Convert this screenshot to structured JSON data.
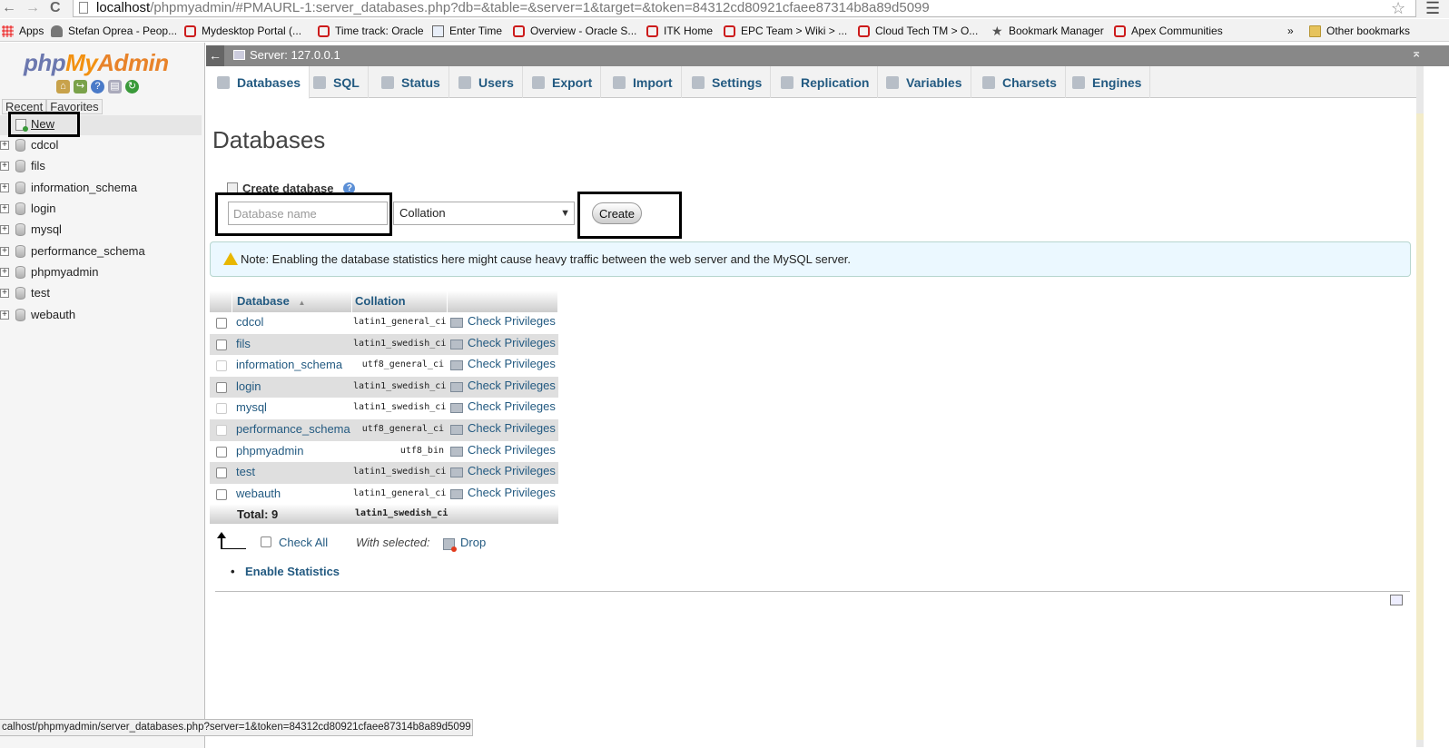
{
  "browser": {
    "url_host": "localhost",
    "url_path": "/phpmyadmin/#PMAURL-1:server_databases.php?db=&table=&server=1&target=&token=84312cd80921cfaee87314b8a89d5099",
    "nav_back": "←",
    "nav_forward": "→",
    "reload": "C",
    "star": "☆",
    "menu": "☰",
    "bookmarks": [
      {
        "label": "Apps",
        "icon": "apps-icon"
      },
      {
        "label": "Stefan Oprea - Peop...",
        "icon": "person-icon"
      },
      {
        "label": "Mydesktop Portal (...",
        "icon": "oracle-icon"
      },
      {
        "label": "Time track: Oracle",
        "icon": "oracle-icon"
      },
      {
        "label": "Enter Time",
        "icon": "page-icon"
      },
      {
        "label": "Overview - Oracle S...",
        "icon": "oracle-icon"
      },
      {
        "label": "ITK Home",
        "icon": "oracle-icon"
      },
      {
        "label": "EPC Team > Wiki > ...",
        "icon": "wiki-icon"
      },
      {
        "label": "Cloud Tech TM > O...",
        "icon": "wiki-icon"
      },
      {
        "label": "Bookmark Manager",
        "icon": "star-icon"
      },
      {
        "label": "Apex Communities",
        "icon": "oracle-icon"
      }
    ],
    "bookmarks_more": "»",
    "other_bookmarks": "Other bookmarks",
    "status_url": "calhost/phpmyadmin/server_databases.php?server=1&token=84312cd80921cfaee87314b8a89d5099"
  },
  "left": {
    "logo_php": "php",
    "logo_my": "My",
    "logo_admin": "Admin",
    "tab_recent": "Recent",
    "tab_favorites": "Favorites",
    "new_label": "New",
    "databases": [
      "cdcol",
      "fils",
      "information_schema",
      "login",
      "mysql",
      "performance_schema",
      "phpmyadmin",
      "test",
      "webauth"
    ]
  },
  "server": {
    "back": "←",
    "title": "Server: 127.0.0.1",
    "collapse": "⌅"
  },
  "menu": [
    {
      "label": "Databases",
      "active": true
    },
    {
      "label": "SQL"
    },
    {
      "label": "Status"
    },
    {
      "label": "Users"
    },
    {
      "label": "Export"
    },
    {
      "label": "Import"
    },
    {
      "label": "Settings"
    },
    {
      "label": "Replication"
    },
    {
      "label": "Variables"
    },
    {
      "label": "Charsets"
    },
    {
      "label": "Engines"
    }
  ],
  "main": {
    "title": "Databases",
    "create_legend": "Create database",
    "dbname_placeholder": "Database name",
    "collation": "Collation",
    "create_button": "Create",
    "note": "Note: Enabling the database statistics here might cause heavy traffic between the web server and the MySQL server.",
    "table": {
      "col_database": "Database",
      "sort_indicator": "▲",
      "col_collation": "Collation",
      "rows": [
        {
          "name": "cdcol",
          "collation": "latin1_general_ci",
          "action": "Check Privileges"
        },
        {
          "name": "fils",
          "collation": "latin1_swedish_ci",
          "action": "Check Privileges"
        },
        {
          "name": "information_schema",
          "collation": "utf8_general_ci",
          "action": "Check Privileges"
        },
        {
          "name": "login",
          "collation": "latin1_swedish_ci",
          "action": "Check Privileges"
        },
        {
          "name": "mysql",
          "collation": "latin1_swedish_ci",
          "action": "Check Privileges"
        },
        {
          "name": "performance_schema",
          "collation": "utf8_general_ci",
          "action": "Check Privileges"
        },
        {
          "name": "phpmyadmin",
          "collation": "utf8_bin",
          "action": "Check Privileges"
        },
        {
          "name": "test",
          "collation": "latin1_swedish_ci",
          "action": "Check Privileges"
        },
        {
          "name": "webauth",
          "collation": "latin1_general_ci",
          "action": "Check Privileges"
        }
      ],
      "total_label": "Total: 9",
      "total_collation": "latin1_swedish_ci"
    },
    "check_all": "Check All",
    "with_selected": "With selected:",
    "drop": "Drop",
    "enable_statistics": "Enable Statistics"
  },
  "colors": {
    "link": "#235a81",
    "logo_php": "#6c78af",
    "logo_myadmin": "#f29111",
    "server_bar": "#888888",
    "note_bg": "#ebf8ff",
    "highlight_box": "#000000"
  }
}
